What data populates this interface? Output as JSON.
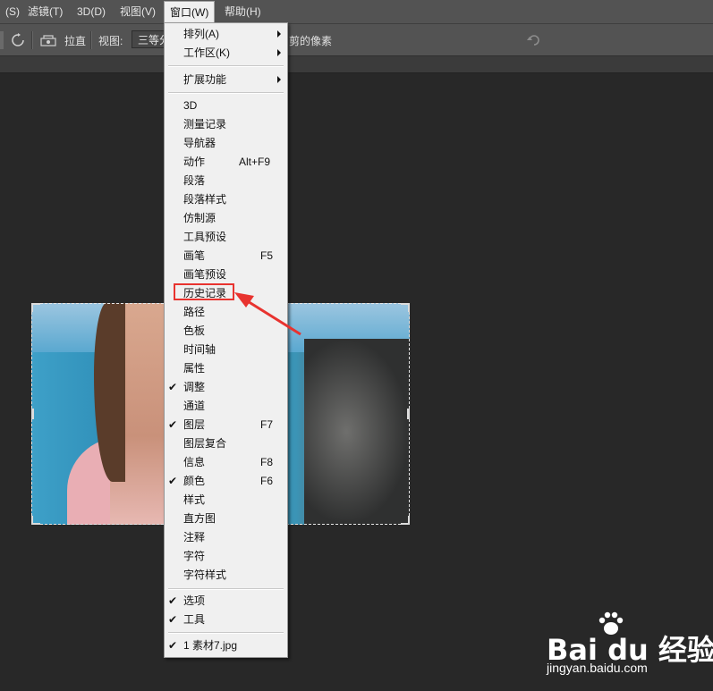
{
  "menubar": {
    "items": [
      "(S)",
      "滤镜(T)",
      "3D(D)",
      "视图(V)",
      "窗口(W)",
      "帮助(H)"
    ]
  },
  "options": {
    "straighten_label": "拉直",
    "view_label": "视图:",
    "view_value": "三等分",
    "delete_pixels_label": "剪的像素"
  },
  "menu": {
    "group1": [
      {
        "label": "排列(A)",
        "submenu": true
      },
      {
        "label": "工作区(K)",
        "submenu": true
      }
    ],
    "group2": [
      {
        "label": "扩展功能",
        "submenu": true
      }
    ],
    "group3": [
      {
        "label": "3D",
        "shortcut": "",
        "checked": false
      },
      {
        "label": "测量记录",
        "shortcut": "",
        "checked": false
      },
      {
        "label": "导航器",
        "shortcut": "",
        "checked": false
      },
      {
        "label": "动作",
        "shortcut": "Alt+F9",
        "checked": false
      },
      {
        "label": "段落",
        "shortcut": "",
        "checked": false
      },
      {
        "label": "段落样式",
        "shortcut": "",
        "checked": false
      },
      {
        "label": "仿制源",
        "shortcut": "",
        "checked": false
      },
      {
        "label": "工具预设",
        "shortcut": "",
        "checked": false
      },
      {
        "label": "画笔",
        "shortcut": "F5",
        "checked": false
      },
      {
        "label": "画笔预设",
        "shortcut": "",
        "checked": false
      },
      {
        "label": "历史记录",
        "shortcut": "",
        "checked": false
      },
      {
        "label": "路径",
        "shortcut": "",
        "checked": false
      },
      {
        "label": "色板",
        "shortcut": "",
        "checked": false
      },
      {
        "label": "时间轴",
        "shortcut": "",
        "checked": false
      },
      {
        "label": "属性",
        "shortcut": "",
        "checked": false
      },
      {
        "label": "调整",
        "shortcut": "",
        "checked": true
      },
      {
        "label": "通道",
        "shortcut": "",
        "checked": false
      },
      {
        "label": "图层",
        "shortcut": "F7",
        "checked": true
      },
      {
        "label": "图层复合",
        "shortcut": "",
        "checked": false
      },
      {
        "label": "信息",
        "shortcut": "F8",
        "checked": false
      },
      {
        "label": "颜色",
        "shortcut": "F6",
        "checked": true
      },
      {
        "label": "样式",
        "shortcut": "",
        "checked": false
      },
      {
        "label": "直方图",
        "shortcut": "",
        "checked": false
      },
      {
        "label": "注释",
        "shortcut": "",
        "checked": false
      },
      {
        "label": "字符",
        "shortcut": "",
        "checked": false
      },
      {
        "label": "字符样式",
        "shortcut": "",
        "checked": false
      }
    ],
    "group4": [
      {
        "label": "选项",
        "checked": true
      },
      {
        "label": "工具",
        "checked": true
      }
    ],
    "group5": [
      {
        "label": "1 素材7.jpg",
        "checked": true
      }
    ]
  },
  "watermark": {
    "brand": "Bai du 经验",
    "url": "jingyan.baidu.com"
  },
  "colors": {
    "menu_bg": "#f0f0f0",
    "annotation_red": "#e8332f",
    "workspace_bg": "#282828"
  }
}
